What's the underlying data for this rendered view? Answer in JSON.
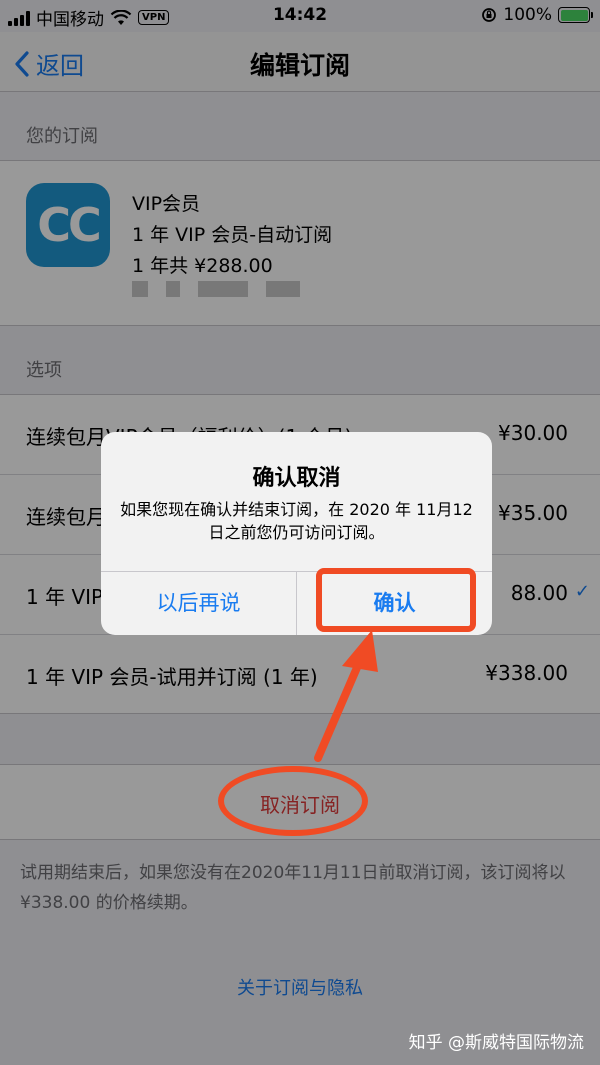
{
  "status_bar": {
    "carrier": "中国移动",
    "vpn": "VPN",
    "time": "14:42",
    "battery": "100%"
  },
  "nav": {
    "back_label": "返回",
    "title": "编辑订阅"
  },
  "subscription_section": {
    "header": "您的订阅",
    "app_icon_text": "CC",
    "name": "VIP会员",
    "plan": "1 年 VIP 会员-自动订阅",
    "price": "1 年共 ¥288.00"
  },
  "options_section": {
    "header": "选项",
    "items": [
      {
        "label": "连续包月VIP会员（福利价）(1 个月)",
        "price": "¥30.00",
        "selected": false
      },
      {
        "label": "连续包月",
        "price": "¥35.00",
        "selected": false
      },
      {
        "label": "1 年 VIP",
        "price": "88.00",
        "selected": true
      },
      {
        "label": "1 年 VIP 会员-试用并订阅 (1 年)",
        "price": "¥338.00",
        "selected": false
      }
    ]
  },
  "cancel_subscription": "取消订阅",
  "note": "试用期结束后，如果您没有在2020年11月11日前取消订阅，该订阅将以 ¥338.00 的价格续期。",
  "privacy_link": "关于订阅与隐私",
  "watermark": "知乎 @斯威特国际物流",
  "alert": {
    "title": "确认取消",
    "message": "如果您现在确认并结束订阅，在 2020 年 11月12日之前您仍可访问订阅。",
    "later_button": "以后再说",
    "confirm_button": "确认"
  },
  "colors": {
    "accent": "#1a7cf0",
    "annotation": "#f04b24",
    "destructive": "#e03a3a",
    "app_icon": "#2196d3"
  }
}
